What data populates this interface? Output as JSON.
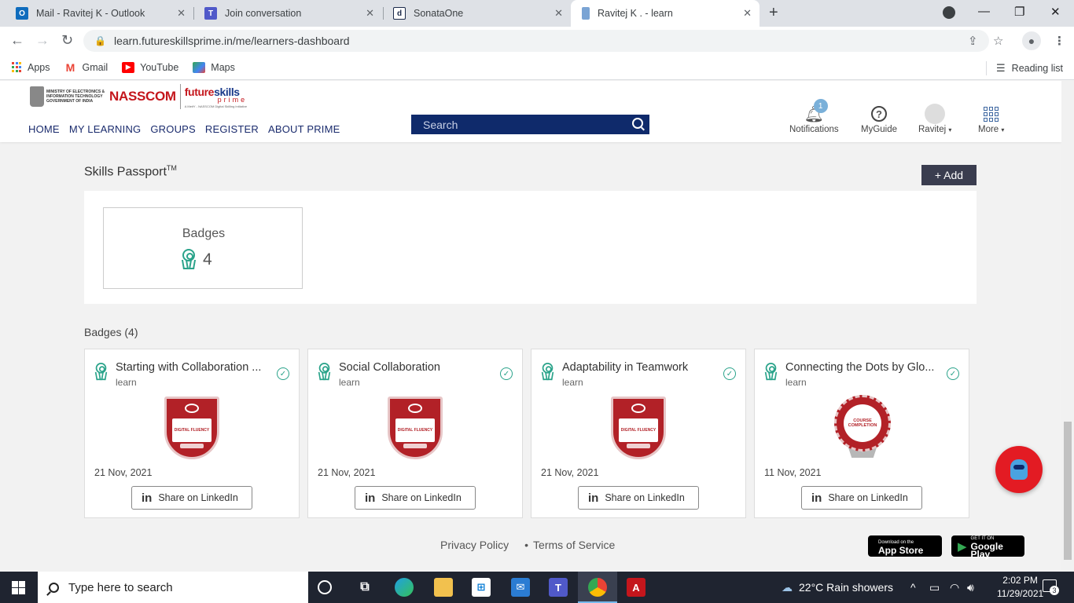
{
  "browser": {
    "tabs": [
      {
        "title": "Mail - Ravitej K - Outlook",
        "icon": "outlook-icon",
        "color": "#0f6cbd"
      },
      {
        "title": "Join conversation",
        "icon": "teams-icon",
        "color": "#5059c9"
      },
      {
        "title": "SonataOne",
        "icon": "sonataone-icon",
        "color": "#1b2a4a"
      },
      {
        "title": "Ravitej K . - learn",
        "icon": "learn-icon",
        "color": "#7aa4d4"
      }
    ],
    "url": "learn.futureskillsprime.in/me/learners-dashboard",
    "bookmarks": [
      {
        "label": "Apps"
      },
      {
        "label": "Gmail"
      },
      {
        "label": "YouTube"
      },
      {
        "label": "Maps"
      }
    ],
    "reading_list": "Reading list"
  },
  "site": {
    "logo": {
      "ministry": "MINISTRY OF ELECTRONICS & INFORMATION TECHNOLOGY GOVERNMENT OF INDIA",
      "nasscom": "NASSCOM",
      "fsp_future": "future",
      "fsp_skills": "skills",
      "fsp_prime": "prime",
      "fsp_tag": "A MeitY - NASSCOM Digital Skilling Initiative"
    },
    "nav": [
      "HOME",
      "MY LEARNING",
      "GROUPS",
      "REGISTER",
      "ABOUT PRIME"
    ],
    "search_placeholder": "Search",
    "header_items": {
      "notifications": "Notifications",
      "notifications_count": "1",
      "myguide": "MyGuide",
      "user": "Ravitej",
      "more": "More"
    }
  },
  "skills_passport": {
    "title": "Skills Passport",
    "tm": "TM",
    "add_button": "+ Add",
    "badges_label": "Badges",
    "badges_count": "4"
  },
  "badges": {
    "heading": "Badges (4)",
    "items": [
      {
        "title": "Starting with Collaboration ...",
        "source": "learn",
        "date": "21 Nov, 2021",
        "share": "Share on LinkedIn",
        "image_text": "DIGITAL FLUENCY",
        "type": "shield"
      },
      {
        "title": "Social Collaboration",
        "source": "learn",
        "date": "21 Nov, 2021",
        "share": "Share on LinkedIn",
        "image_text": "DIGITAL FLUENCY",
        "type": "shield"
      },
      {
        "title": "Adaptability in Teamwork",
        "source": "learn",
        "date": "21 Nov, 2021",
        "share": "Share on LinkedIn",
        "image_text": "DIGITAL FLUENCY",
        "type": "shield"
      },
      {
        "title": "Connecting the Dots by Glo...",
        "source": "learn",
        "date": "11 Nov, 2021",
        "share": "Share on LinkedIn",
        "image_text": "COURSE COMPLETION",
        "type": "seal"
      }
    ]
  },
  "footer": {
    "privacy": "Privacy Policy",
    "terms": "Terms of Service",
    "app_store_small": "Download on the",
    "app_store": "App Store",
    "play_small": "GET IT ON",
    "play": "Google Play"
  },
  "taskbar": {
    "search_placeholder": "Type here to search",
    "weather": "22°C  Rain showers",
    "time": "2:02 PM",
    "date": "11/29/2021",
    "notification_count": "3"
  }
}
